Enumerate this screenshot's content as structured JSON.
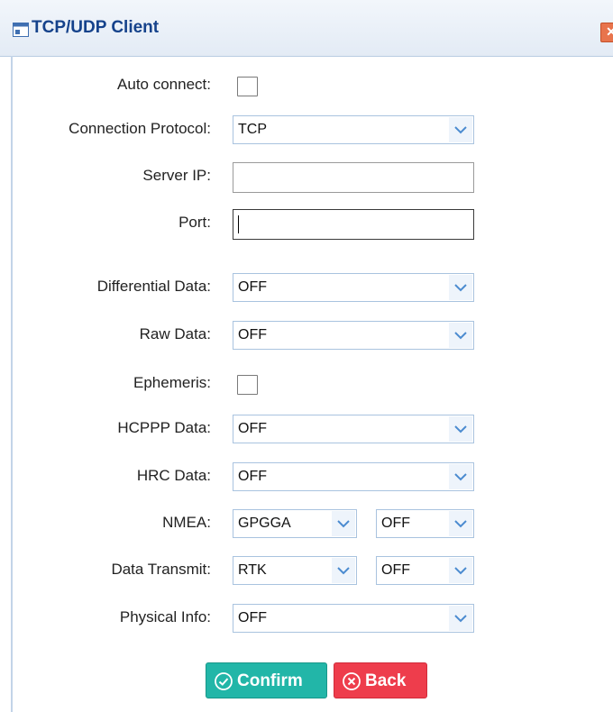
{
  "dialog": {
    "title": "TCP/UDP Client",
    "close_icon": "close-icon"
  },
  "form": {
    "auto_connect": {
      "label": "Auto connect:",
      "checked": false
    },
    "connection_protocol": {
      "label": "Connection Protocol:",
      "value": "TCP"
    },
    "server_ip": {
      "label": "Server IP:",
      "value": ""
    },
    "port": {
      "label": "Port:",
      "value": ""
    },
    "differential_data": {
      "label": "Differential Data:",
      "value": "OFF"
    },
    "raw_data": {
      "label": "Raw Data:",
      "value": "OFF"
    },
    "ephemeris": {
      "label": "Ephemeris:",
      "checked": false
    },
    "hcppp_data": {
      "label": "HCPPP Data:",
      "value": "OFF"
    },
    "hrc_data": {
      "label": "HRC Data:",
      "value": "OFF"
    },
    "nmea": {
      "label": "NMEA:",
      "type_value": "GPGGA",
      "rate_value": "OFF"
    },
    "data_transmit": {
      "label": "Data Transmit:",
      "type_value": "RTK",
      "rate_value": "OFF"
    },
    "physical_info": {
      "label": "Physical Info:",
      "value": "OFF"
    }
  },
  "buttons": {
    "confirm": "Confirm",
    "back": "Back"
  },
  "colors": {
    "title_text": "#15428b",
    "confirm_bg": "#22b6a8",
    "back_bg": "#ee3d4c",
    "close_bg": "#e8744c",
    "select_border": "#a9c3df"
  }
}
